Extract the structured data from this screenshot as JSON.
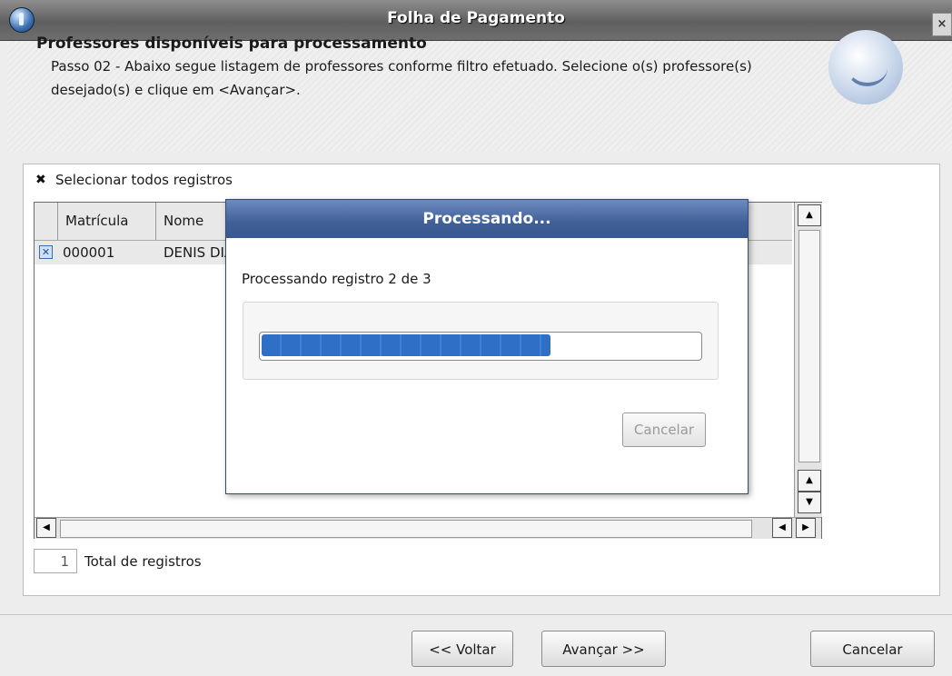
{
  "window": {
    "title": "Folha de Pagamento",
    "close": "×"
  },
  "header": {
    "title": "Professores disponíveis para processamento",
    "description": "Passo 02 - Abaixo segue listagem de professores conforme filtro efetuado. Selecione o(s) professore(s) desejado(s) e clique em <Avançar>."
  },
  "select_all": {
    "label": "Selecionar todos registros",
    "checked": true
  },
  "grid": {
    "columns": [
      "Matrícula",
      "Nome"
    ],
    "rows": [
      {
        "matricula": "000001",
        "nome": "DENIS DIAS",
        "checked": true
      }
    ]
  },
  "total": {
    "count": "1",
    "label": "Total de registros"
  },
  "buttons": {
    "back": "<< Voltar",
    "next": "Avançar >>",
    "cancel": "Cancelar"
  },
  "dialog": {
    "title": "Processando...",
    "message": "Processando registro 2 de 3",
    "progress_fraction": 0.66,
    "cancel": "Cancelar"
  }
}
